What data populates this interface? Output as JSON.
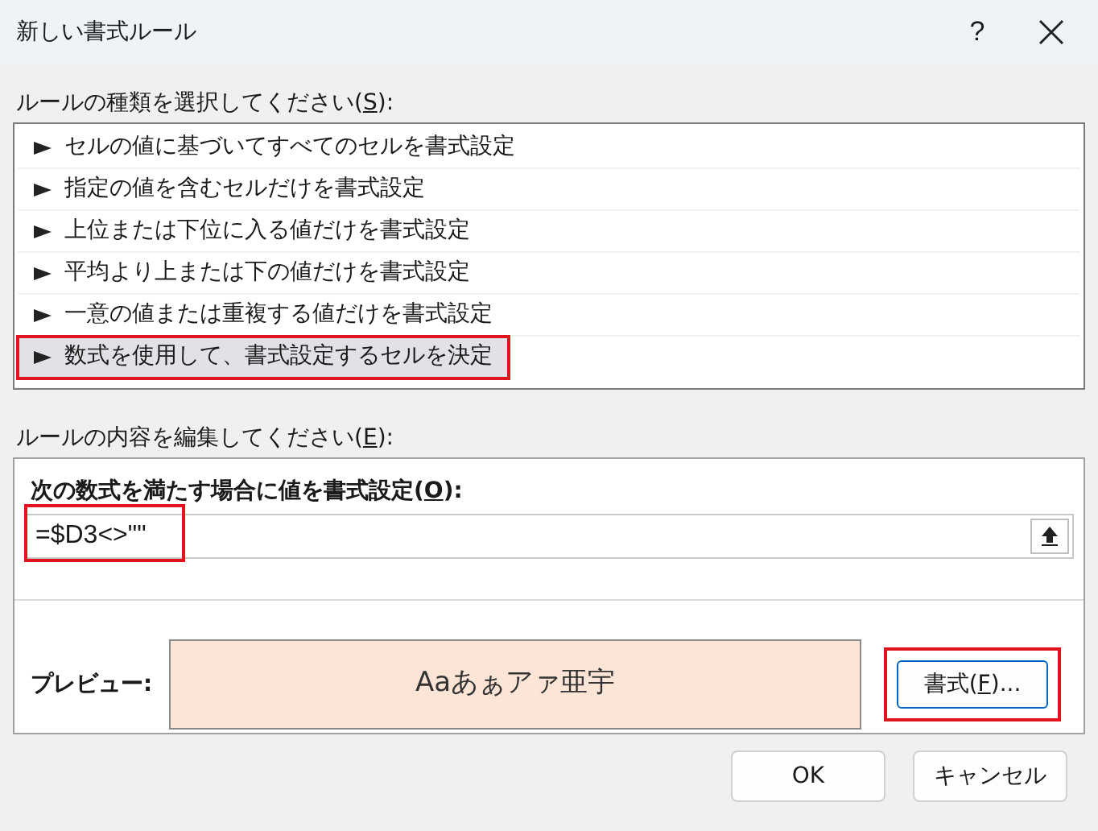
{
  "window": {
    "title": "新しい書式ルール",
    "help": "?"
  },
  "rule_type": {
    "label": {
      "before": "ルールの種類を選択してください(",
      "key": "S",
      "after": "):"
    },
    "items": [
      {
        "label": "セルの値に基づいてすべてのセルを書式設定",
        "selected": false,
        "highlighted": false
      },
      {
        "label": "指定の値を含むセルだけを書式設定",
        "selected": false,
        "highlighted": false
      },
      {
        "label": "上位または下位に入る値だけを書式設定",
        "selected": false,
        "highlighted": false
      },
      {
        "label": "平均より上または下の値だけを書式設定",
        "selected": false,
        "highlighted": false
      },
      {
        "label": "一意の値または重複する値だけを書式設定",
        "selected": false,
        "highlighted": false
      },
      {
        "label": "数式を使用して、書式設定するセルを決定",
        "selected": true,
        "highlighted": true
      }
    ]
  },
  "rule_edit": {
    "label": {
      "before": "ルールの内容を編集してください(",
      "key": "E",
      "after": "):"
    },
    "formula_label": {
      "before": "次の数式を満たす場合に値を書式設定(",
      "key": "O",
      "after": "):"
    },
    "formula": {
      "value": "=$D3<>\"\"",
      "highlighted": true
    },
    "preview": {
      "label": "プレビュー:",
      "sample": "Aaあぁアァ亜宇"
    },
    "format_button": {
      "before": "書式(",
      "key": "F",
      "after": ")...",
      "highlighted": true
    }
  },
  "buttons": [
    "OK",
    "キャンセル"
  ]
}
